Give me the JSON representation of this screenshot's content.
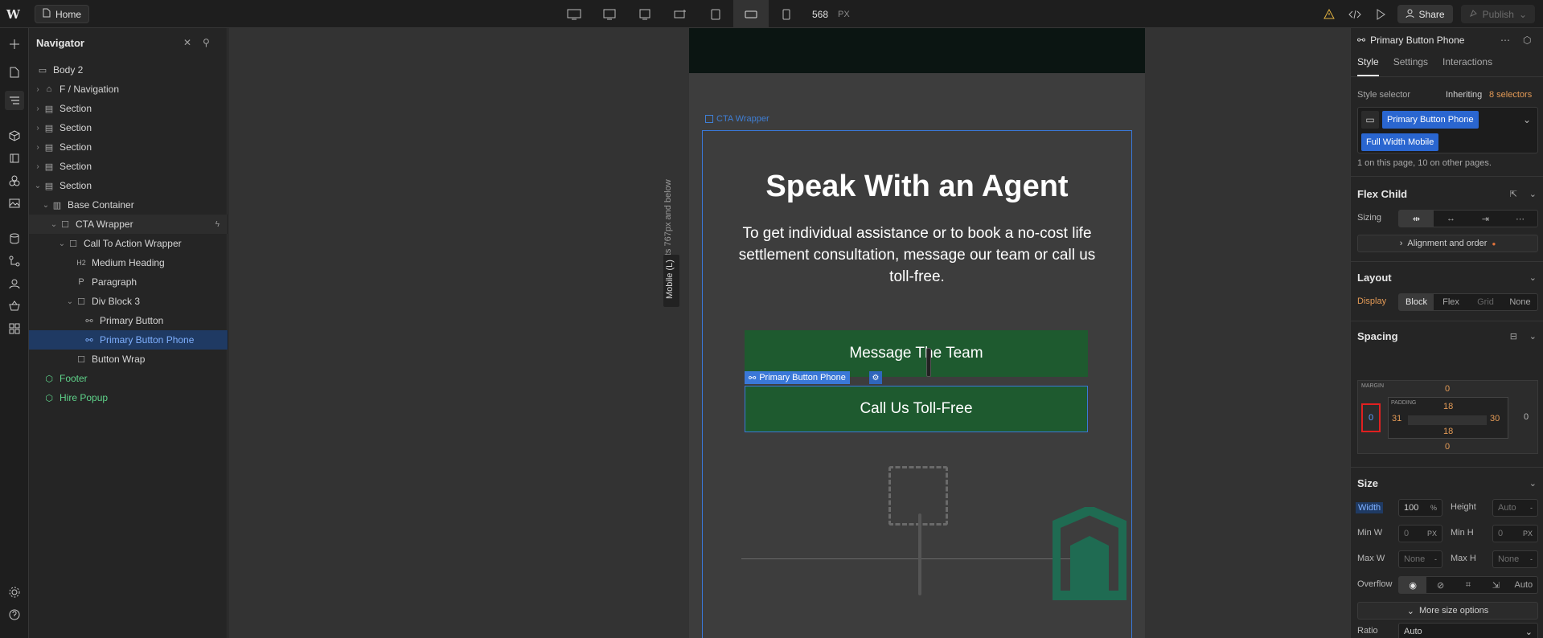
{
  "topbar": {
    "home_label": "Home",
    "breakpoint_width": "568",
    "breakpoint_unit": "PX",
    "share_label": "Share",
    "publish_label": "Publish"
  },
  "navigator": {
    "title": "Navigator",
    "tree": [
      {
        "label": "Body 2",
        "icon": "body-icon"
      },
      {
        "label": "F / Navigation",
        "icon": "component-icon"
      },
      {
        "label": "Section",
        "icon": "section-icon"
      },
      {
        "label": "Section",
        "icon": "section-icon"
      },
      {
        "label": "Section",
        "icon": "section-icon"
      },
      {
        "label": "Section",
        "icon": "section-icon"
      },
      {
        "label": "Section",
        "icon": "section-icon"
      },
      {
        "label": "Base Container",
        "icon": "container-icon"
      },
      {
        "label": "CTA Wrapper",
        "icon": "div-icon"
      },
      {
        "label": "Call To Action Wrapper",
        "icon": "div-icon"
      },
      {
        "label": "Medium Heading",
        "icon": "H2"
      },
      {
        "label": "Paragraph",
        "icon": "P"
      },
      {
        "label": "Div Block 3",
        "icon": "div-icon"
      },
      {
        "label": "Primary Button",
        "icon": "link-icon"
      },
      {
        "label": "Primary Button Phone",
        "icon": "link-icon"
      },
      {
        "label": "Button Wrap",
        "icon": "div-icon"
      },
      {
        "label": "Footer",
        "icon": "component-icon"
      },
      {
        "label": "Hire Popup",
        "icon": "component-icon"
      }
    ]
  },
  "canvas": {
    "affects_text": "Affects 767px and below",
    "mobile_tag": "Mobile (L)",
    "cta_tag": "CTA Wrapper",
    "heading": "Speak With an Agent",
    "paragraph": "To get individual assistance or to book a no-cost life settlement consultation, message our team or call us toll-free.",
    "button1": "Message The Team",
    "button2": "Call Us Toll-Free",
    "selected_tag": "Primary Button Phone"
  },
  "panel": {
    "element_name": "Primary Button Phone",
    "tabs": [
      "Style",
      "Settings",
      "Interactions"
    ],
    "style_selector_label": "Style selector",
    "inheriting_prefix": "Inheriting",
    "inheriting_count": "8 selectors",
    "chip1": "Primary Button Phone",
    "chip2": "Full Width Mobile",
    "usage_text": "1 on this page, 10 on other pages.",
    "flex_child_title": "Flex Child",
    "sizing_label": "Sizing",
    "alignment_label": "Alignment and order",
    "layout_title": "Layout",
    "display_label": "Display",
    "display_options": [
      "Block",
      "Flex",
      "Grid",
      "None"
    ],
    "spacing_title": "Spacing",
    "margin_label": "MARGIN",
    "padding_label": "PADDING",
    "margin": {
      "top": "0",
      "right": "0",
      "bottom": "0",
      "left": "0"
    },
    "padding": {
      "top": "18",
      "right": "30",
      "bottom": "18",
      "left": "31"
    },
    "size_title": "Size",
    "width_label": "Width",
    "width_value": "100",
    "width_unit": "%",
    "height_label": "Height",
    "height_value": "Auto",
    "minw_label": "Min W",
    "minw_value": "0",
    "minh_label": "Min H",
    "minh_value": "0",
    "maxw_label": "Max W",
    "maxw_value": "None",
    "maxh_label": "Max H",
    "maxh_value": "None",
    "px_unit": "PX",
    "dash_unit": "-",
    "overflow_label": "Overflow",
    "overflow_auto": "Auto",
    "more_size_label": "More size options",
    "ratio_label": "Ratio",
    "ratio_value": "Auto"
  },
  "colors": {
    "accent": "#3a78d8",
    "button_green": "#1e5a2f",
    "component_green": "#5fd38a",
    "orange_value": "#e39a56"
  }
}
